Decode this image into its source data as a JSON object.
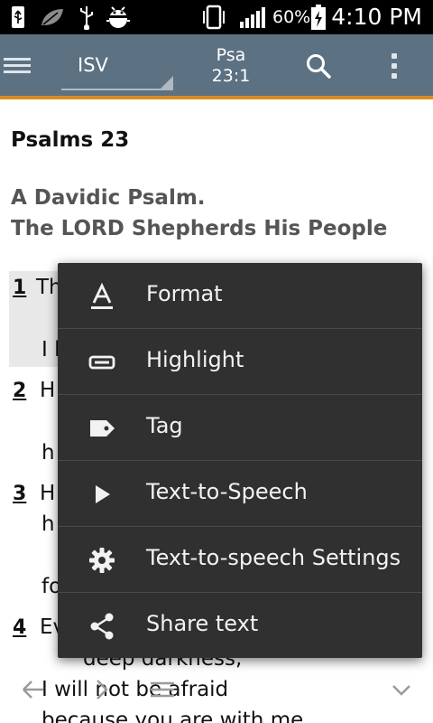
{
  "status_bar": {
    "battery_percent": "60%",
    "time": "4:10 PM"
  },
  "app_bar": {
    "version": "ISV",
    "reference_book": "Psa",
    "reference_location": "23:1"
  },
  "content": {
    "chapter_title": "Psalms 23",
    "headings": [
      "A Davidic Psalm.",
      "The LORD Shepherds His People"
    ],
    "verses": [
      {
        "number": "1",
        "lines": [
          "Th",
          "I l"
        ]
      },
      {
        "number": "2",
        "lines": [
          "H",
          "h"
        ]
      },
      {
        "number": "3",
        "lines": [
          "H",
          "h",
          "fo"
        ]
      },
      {
        "number": "4",
        "lines": [
          "Ev",
          "deep darkness,",
          "I will not be afraid",
          "because you are with me"
        ]
      }
    ]
  },
  "popup_menu": {
    "items": [
      {
        "label": "Format",
        "icon": "format-text-icon"
      },
      {
        "label": "Highlight",
        "icon": "highlight-icon"
      },
      {
        "label": "Tag",
        "icon": "tag-icon"
      },
      {
        "label": "Text-to-Speech",
        "icon": "play-icon"
      },
      {
        "label": "Text-to-speech Settings",
        "icon": "gear-icon"
      },
      {
        "label": "Share text",
        "icon": "share-icon"
      }
    ]
  },
  "colors": {
    "app_bar": "#5c7182",
    "accent": "#d98d20",
    "menu_background": "#303030"
  }
}
